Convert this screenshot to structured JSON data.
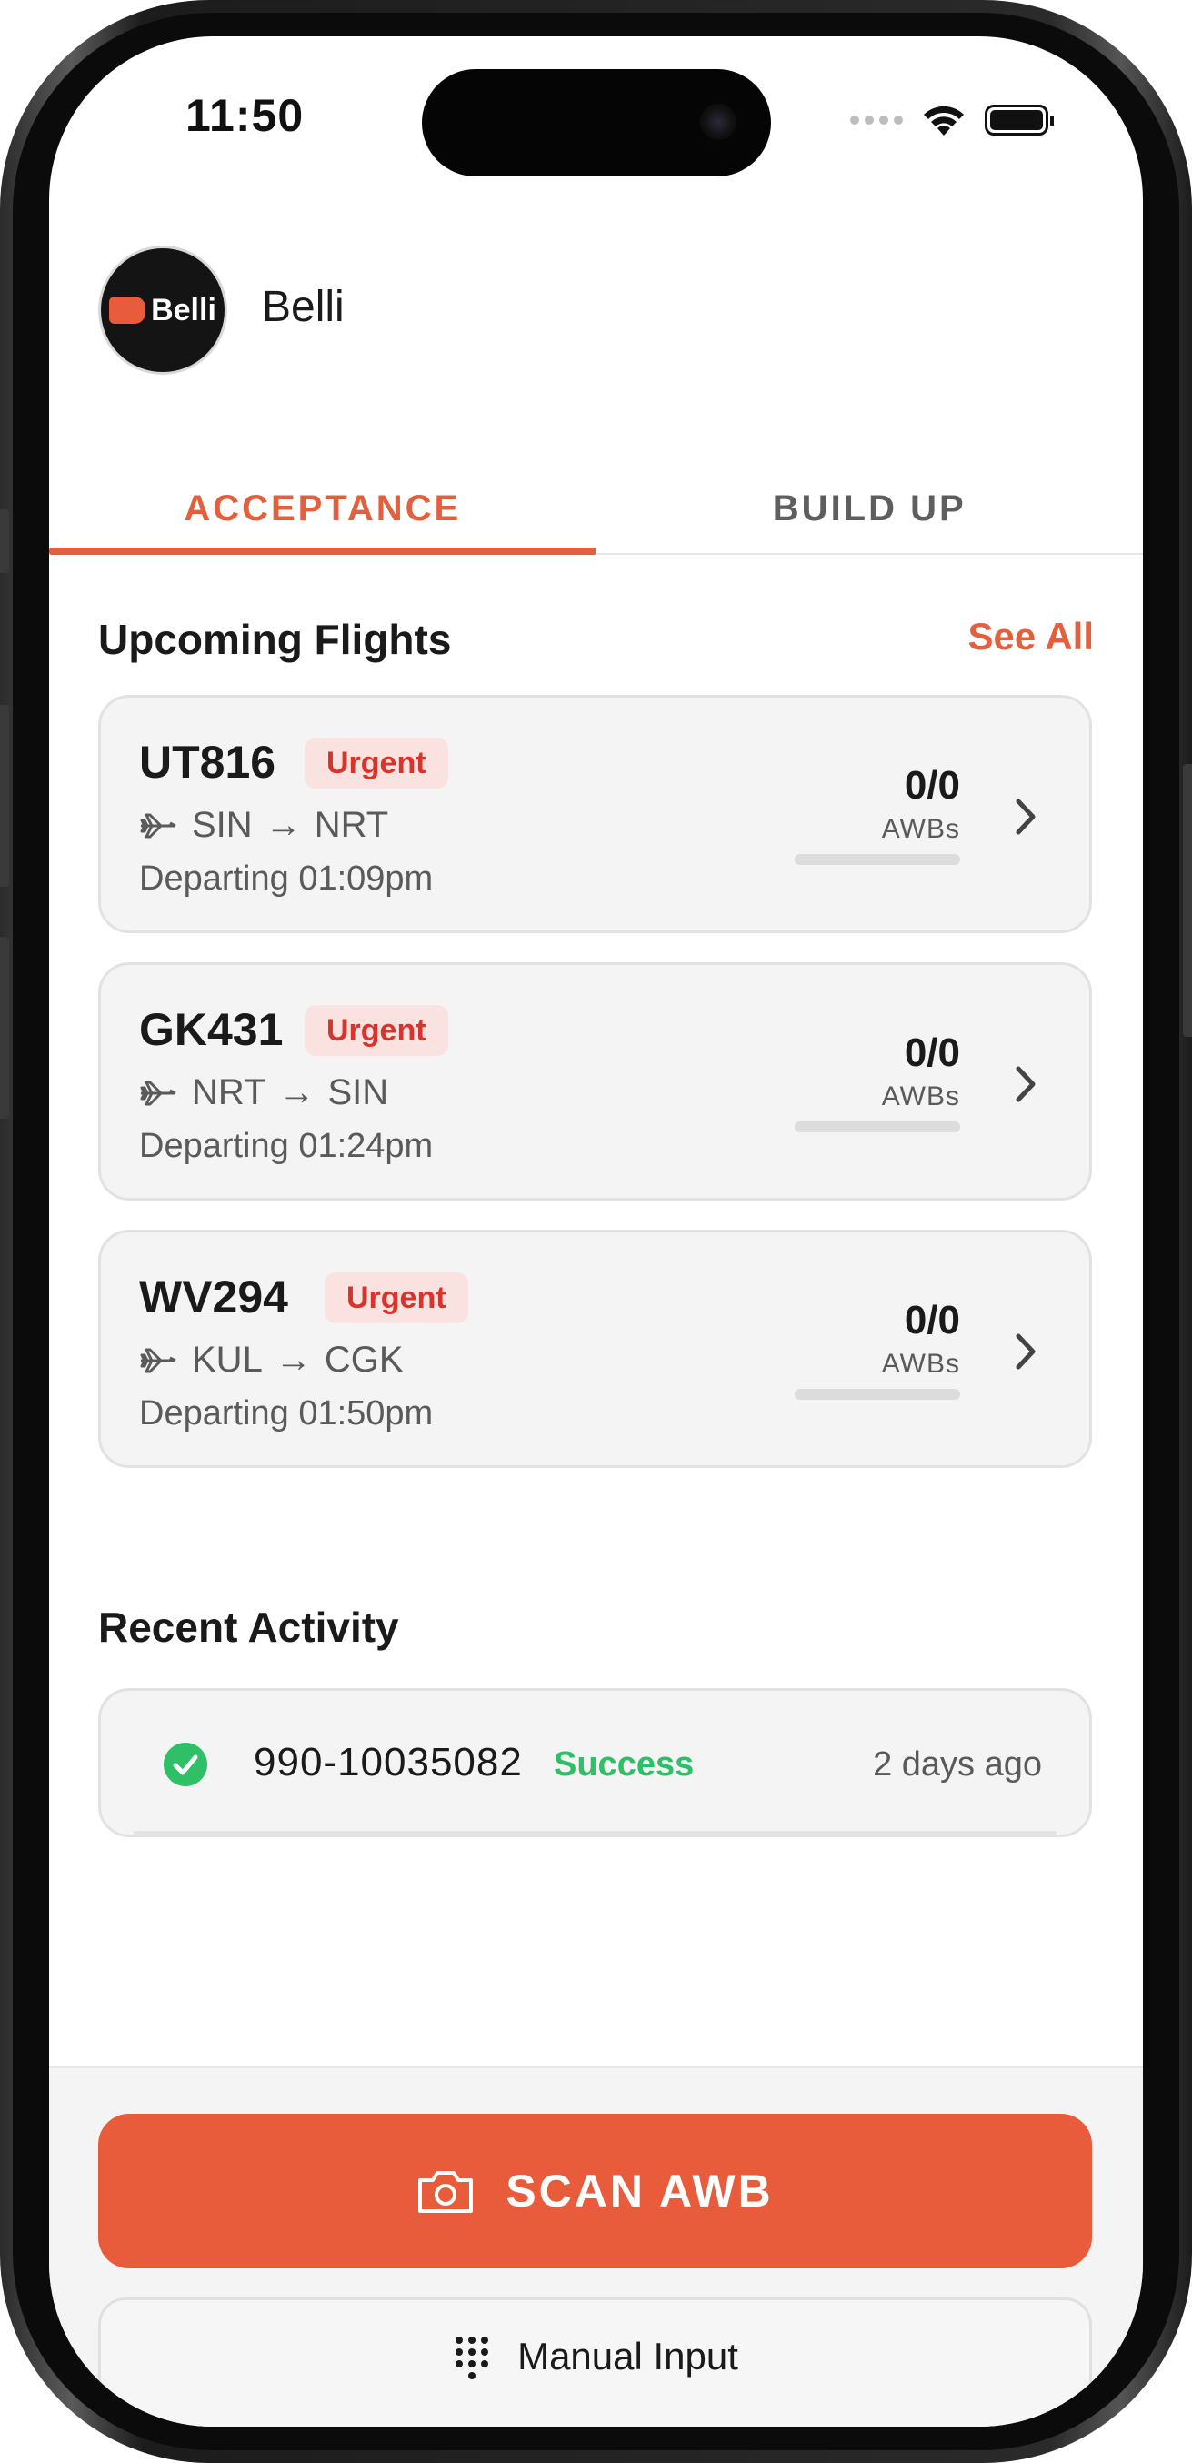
{
  "status_bar": {
    "time": "11:50"
  },
  "header": {
    "logo_text": "Belli",
    "user_name": "Belli"
  },
  "tabs": [
    {
      "label": "ACCEPTANCE",
      "active": true
    },
    {
      "label": "BUILD UP",
      "active": false
    }
  ],
  "upcoming": {
    "title": "Upcoming Flights",
    "see_all": "See All",
    "flights": [
      {
        "code": "UT816",
        "badge": "Urgent",
        "origin": "SIN",
        "arrow": "→",
        "destination": "NRT",
        "departing": "Departing 01:09pm",
        "count": "0/0",
        "count_label": "AWBs",
        "progress": 0
      },
      {
        "code": "GK431",
        "badge": "Urgent",
        "origin": "NRT",
        "arrow": "→",
        "destination": "SIN",
        "departing": "Departing 01:24pm",
        "count": "0/0",
        "count_label": "AWBs",
        "progress": 0
      },
      {
        "code": "WV294",
        "badge": "Urgent",
        "origin": "KUL",
        "arrow": "→",
        "destination": "CGK",
        "departing": "Departing 01:50pm",
        "count": "0/0",
        "count_label": "AWBs",
        "progress": 0
      }
    ]
  },
  "recent": {
    "title": "Recent Activity",
    "items": [
      {
        "awb": "990-10035082",
        "status": "Success",
        "time": "2 days ago"
      }
    ]
  },
  "actions": {
    "scan_label": "SCAN AWB",
    "manual_label": "Manual Input"
  },
  "colors": {
    "accent": "#e85c3b",
    "urgent_bg": "#f9e2df",
    "urgent_text": "#d9342b",
    "success": "#2fbf66"
  },
  "icons": {
    "plane": "plane-icon",
    "chevron": "chevron-right-icon",
    "check": "check-circle-icon",
    "camera": "camera-icon",
    "keypad": "keypad-icon"
  }
}
